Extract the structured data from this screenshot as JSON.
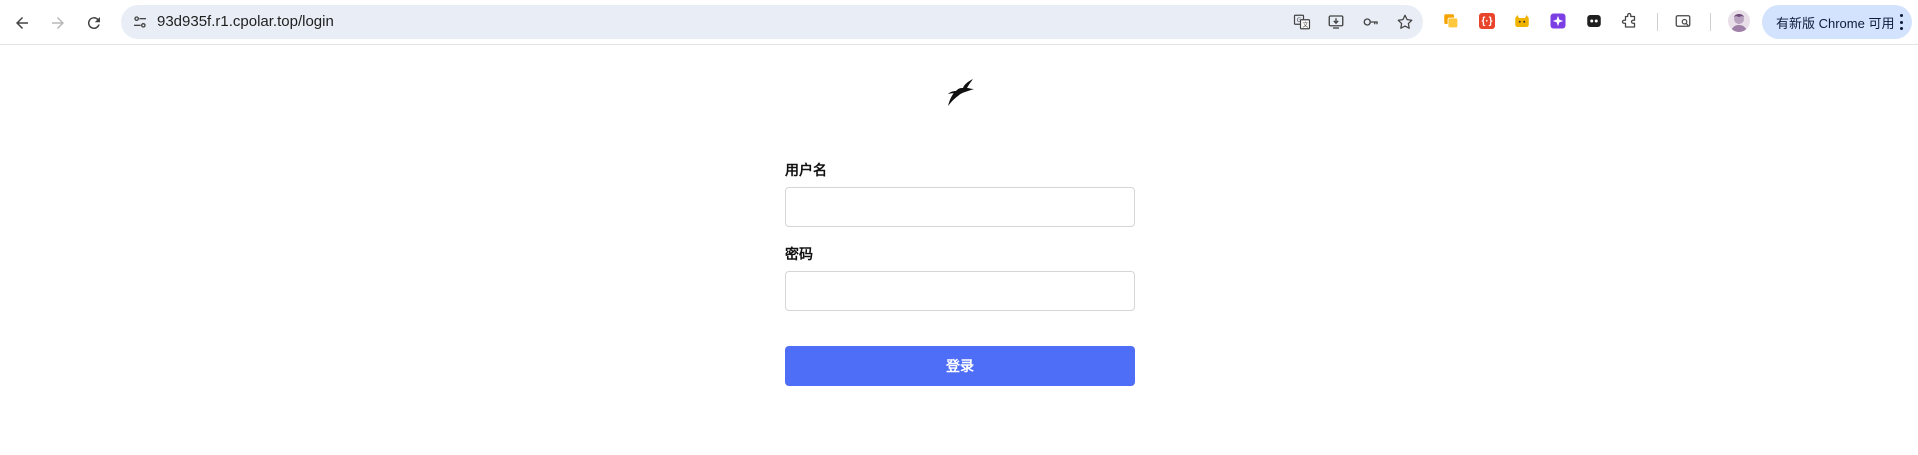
{
  "browser": {
    "url": "93d935f.r1.cpolar.top/login",
    "update_button_label": "有新版 Chrome 可用",
    "nav": {
      "back": "back-icon",
      "forward": "forward-icon",
      "reload": "reload-icon"
    },
    "omnibox_actions": [
      "translate-icon",
      "install-app-icon",
      "password-key-icon",
      "bookmark-star-icon"
    ],
    "extensions": [
      {
        "name": "extension-copy-icon",
        "color": "#f4a300"
      },
      {
        "name": "extension-code-icon",
        "color": "#e8452c"
      },
      {
        "name": "extension-cat-icon",
        "color": "#f0b400"
      },
      {
        "name": "extension-sparkle-icon",
        "color": "#7b3fe4"
      },
      {
        "name": "extension-mask-icon",
        "color": "#1f1f1f"
      },
      {
        "name": "extensions-puzzle-icon",
        "color": "#444444"
      },
      {
        "name": "tab-search-icon",
        "color": "#444444"
      }
    ],
    "accent_color": "#d3e3fd"
  },
  "page": {
    "logo": "bird-logo-icon",
    "username_label": "用户名",
    "password_label": "密码",
    "login_button_label": "登录",
    "button_color": "#4f6ef7"
  }
}
